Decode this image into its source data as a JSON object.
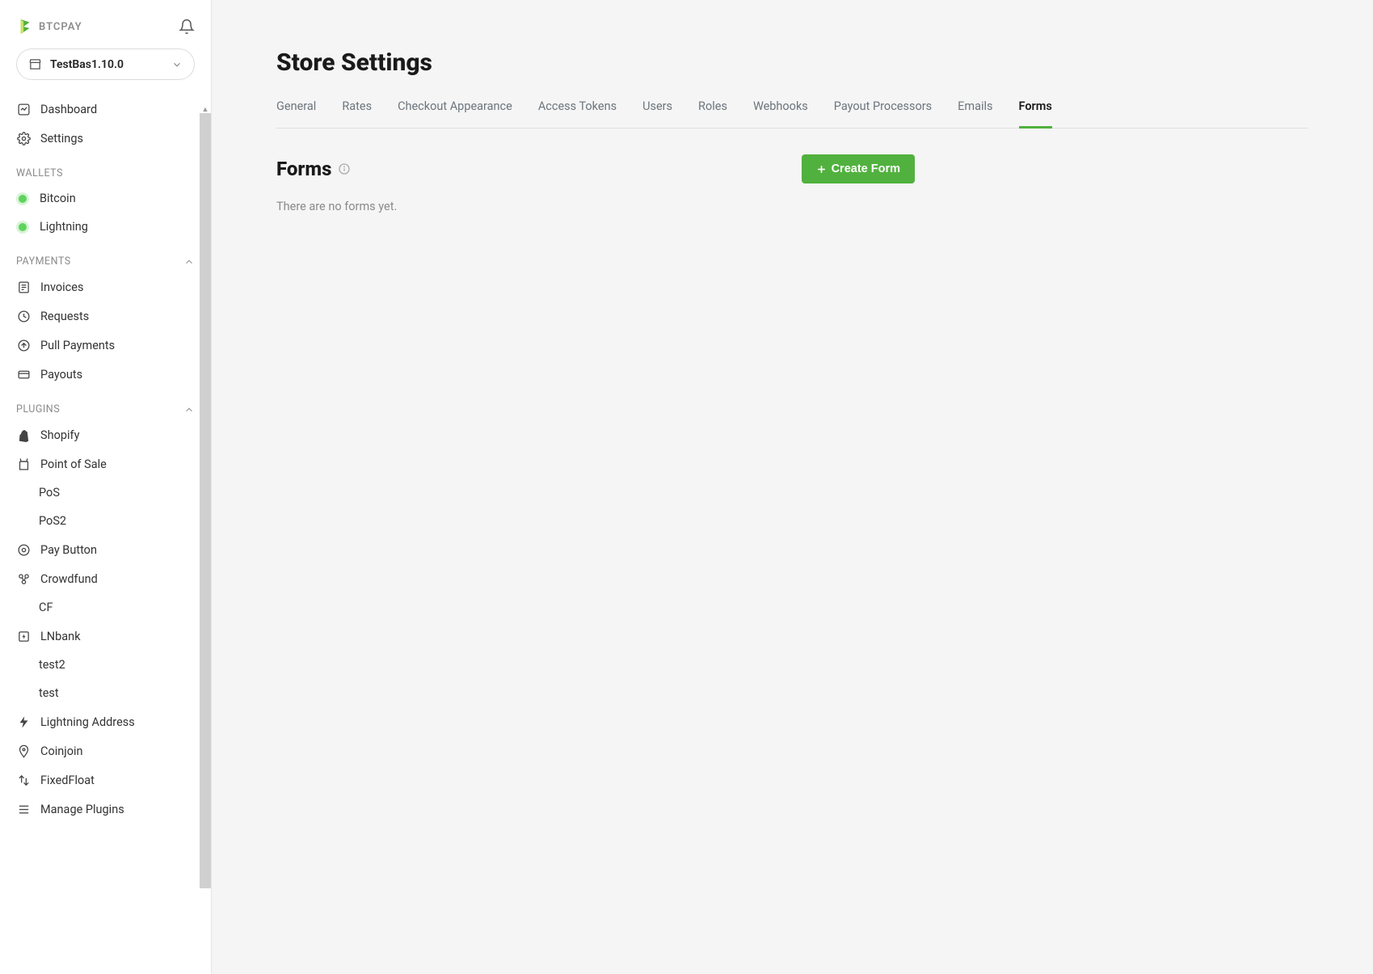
{
  "logo_text": "BTCPAY",
  "store_selector": {
    "name": "TestBas1.10.0"
  },
  "nav": {
    "dashboard": "Dashboard",
    "settings": "Settings"
  },
  "sections": {
    "wallets": {
      "label": "WALLETS",
      "items": {
        "bitcoin": "Bitcoin",
        "lightning": "Lightning"
      }
    },
    "payments": {
      "label": "PAYMENTS",
      "items": {
        "invoices": "Invoices",
        "requests": "Requests",
        "pull_payments": "Pull Payments",
        "payouts": "Payouts"
      }
    },
    "plugins": {
      "label": "PLUGINS",
      "items": {
        "shopify": "Shopify",
        "pos": "Point of Sale",
        "pos_sub1": "PoS",
        "pos_sub2": "PoS2",
        "pay_button": "Pay Button",
        "crowdfund": "Crowdfund",
        "cf_sub": "CF",
        "lnbank": "LNbank",
        "lnbank_test2": "test2",
        "lnbank_test": "test",
        "lightning_address": "Lightning Address",
        "coinjoin": "Coinjoin",
        "fixedfloat": "FixedFloat",
        "manage": "Manage Plugins"
      }
    }
  },
  "page": {
    "title": "Store Settings",
    "tabs": {
      "general": "General",
      "rates": "Rates",
      "checkout": "Checkout Appearance",
      "tokens": "Access Tokens",
      "users": "Users",
      "roles": "Roles",
      "webhooks": "Webhooks",
      "payout": "Payout Processors",
      "emails": "Emails",
      "forms": "Forms"
    },
    "section_title": "Forms",
    "create_button": "Create Form",
    "empty_message": "There are no forms yet."
  }
}
